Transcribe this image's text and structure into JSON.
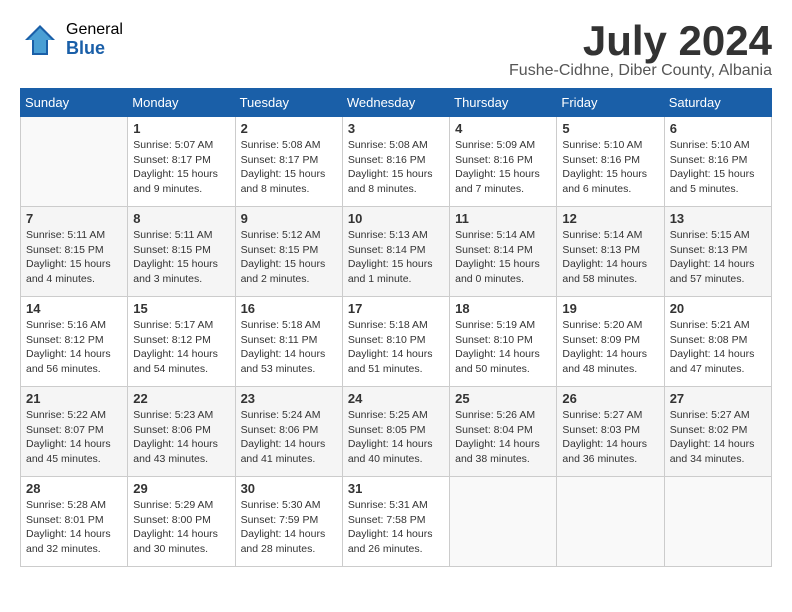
{
  "logo": {
    "general": "General",
    "blue": "Blue"
  },
  "title": "July 2024",
  "location": "Fushe-Cidhne, Diber County, Albania",
  "days_of_week": [
    "Sunday",
    "Monday",
    "Tuesday",
    "Wednesday",
    "Thursday",
    "Friday",
    "Saturday"
  ],
  "weeks": [
    [
      {
        "day": null,
        "text": null
      },
      {
        "day": "1",
        "sunrise": "5:07 AM",
        "sunset": "8:17 PM",
        "daylight": "15 hours and 9 minutes."
      },
      {
        "day": "2",
        "sunrise": "5:08 AM",
        "sunset": "8:17 PM",
        "daylight": "15 hours and 8 minutes."
      },
      {
        "day": "3",
        "sunrise": "5:08 AM",
        "sunset": "8:16 PM",
        "daylight": "15 hours and 8 minutes."
      },
      {
        "day": "4",
        "sunrise": "5:09 AM",
        "sunset": "8:16 PM",
        "daylight": "15 hours and 7 minutes."
      },
      {
        "day": "5",
        "sunrise": "5:10 AM",
        "sunset": "8:16 PM",
        "daylight": "15 hours and 6 minutes."
      },
      {
        "day": "6",
        "sunrise": "5:10 AM",
        "sunset": "8:16 PM",
        "daylight": "15 hours and 5 minutes."
      }
    ],
    [
      {
        "day": "7",
        "sunrise": "5:11 AM",
        "sunset": "8:15 PM",
        "daylight": "15 hours and 4 minutes."
      },
      {
        "day": "8",
        "sunrise": "5:11 AM",
        "sunset": "8:15 PM",
        "daylight": "15 hours and 3 minutes."
      },
      {
        "day": "9",
        "sunrise": "5:12 AM",
        "sunset": "8:15 PM",
        "daylight": "15 hours and 2 minutes."
      },
      {
        "day": "10",
        "sunrise": "5:13 AM",
        "sunset": "8:14 PM",
        "daylight": "15 hours and 1 minute."
      },
      {
        "day": "11",
        "sunrise": "5:14 AM",
        "sunset": "8:14 PM",
        "daylight": "15 hours and 0 minutes."
      },
      {
        "day": "12",
        "sunrise": "5:14 AM",
        "sunset": "8:13 PM",
        "daylight": "14 hours and 58 minutes."
      },
      {
        "day": "13",
        "sunrise": "5:15 AM",
        "sunset": "8:13 PM",
        "daylight": "14 hours and 57 minutes."
      }
    ],
    [
      {
        "day": "14",
        "sunrise": "5:16 AM",
        "sunset": "8:12 PM",
        "daylight": "14 hours and 56 minutes."
      },
      {
        "day": "15",
        "sunrise": "5:17 AM",
        "sunset": "8:12 PM",
        "daylight": "14 hours and 54 minutes."
      },
      {
        "day": "16",
        "sunrise": "5:18 AM",
        "sunset": "8:11 PM",
        "daylight": "14 hours and 53 minutes."
      },
      {
        "day": "17",
        "sunrise": "5:18 AM",
        "sunset": "8:10 PM",
        "daylight": "14 hours and 51 minutes."
      },
      {
        "day": "18",
        "sunrise": "5:19 AM",
        "sunset": "8:10 PM",
        "daylight": "14 hours and 50 minutes."
      },
      {
        "day": "19",
        "sunrise": "5:20 AM",
        "sunset": "8:09 PM",
        "daylight": "14 hours and 48 minutes."
      },
      {
        "day": "20",
        "sunrise": "5:21 AM",
        "sunset": "8:08 PM",
        "daylight": "14 hours and 47 minutes."
      }
    ],
    [
      {
        "day": "21",
        "sunrise": "5:22 AM",
        "sunset": "8:07 PM",
        "daylight": "14 hours and 45 minutes."
      },
      {
        "day": "22",
        "sunrise": "5:23 AM",
        "sunset": "8:06 PM",
        "daylight": "14 hours and 43 minutes."
      },
      {
        "day": "23",
        "sunrise": "5:24 AM",
        "sunset": "8:06 PM",
        "daylight": "14 hours and 41 minutes."
      },
      {
        "day": "24",
        "sunrise": "5:25 AM",
        "sunset": "8:05 PM",
        "daylight": "14 hours and 40 minutes."
      },
      {
        "day": "25",
        "sunrise": "5:26 AM",
        "sunset": "8:04 PM",
        "daylight": "14 hours and 38 minutes."
      },
      {
        "day": "26",
        "sunrise": "5:27 AM",
        "sunset": "8:03 PM",
        "daylight": "14 hours and 36 minutes."
      },
      {
        "day": "27",
        "sunrise": "5:27 AM",
        "sunset": "8:02 PM",
        "daylight": "14 hours and 34 minutes."
      }
    ],
    [
      {
        "day": "28",
        "sunrise": "5:28 AM",
        "sunset": "8:01 PM",
        "daylight": "14 hours and 32 minutes."
      },
      {
        "day": "29",
        "sunrise": "5:29 AM",
        "sunset": "8:00 PM",
        "daylight": "14 hours and 30 minutes."
      },
      {
        "day": "30",
        "sunrise": "5:30 AM",
        "sunset": "7:59 PM",
        "daylight": "14 hours and 28 minutes."
      },
      {
        "day": "31",
        "sunrise": "5:31 AM",
        "sunset": "7:58 PM",
        "daylight": "14 hours and 26 minutes."
      },
      {
        "day": null,
        "text": null
      },
      {
        "day": null,
        "text": null
      },
      {
        "day": null,
        "text": null
      }
    ]
  ]
}
